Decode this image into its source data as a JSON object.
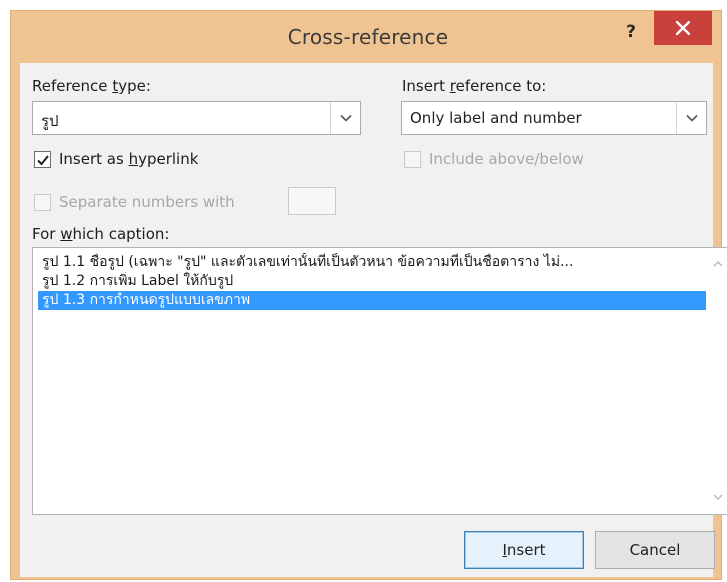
{
  "dialog": {
    "title": "Cross-reference",
    "help_label": "?",
    "close_label": "×"
  },
  "reference_type": {
    "label_prefix": "Reference ",
    "label_accel": "t",
    "label_suffix": "ype:",
    "value": "รูป"
  },
  "insert_reference_to": {
    "label_prefix": "Insert ",
    "label_accel": "r",
    "label_suffix": "eference to:",
    "value": "Only label and number"
  },
  "insert_as_hyperlink": {
    "label_prefix": "Insert as ",
    "label_accel": "h",
    "label_suffix": "yperlink",
    "checked": true
  },
  "include_above_below": {
    "label": "Include above/below",
    "checked": false,
    "enabled": false
  },
  "separate_numbers": {
    "label": "Separate numbers with",
    "checked": false,
    "enabled": false,
    "value": ""
  },
  "caption_list": {
    "label_prefix": "For ",
    "label_accel": "w",
    "label_suffix": "hich caption:",
    "items": [
      {
        "text": "รูป 1.1 ชื่อรูป (เฉพาะ \"รูป\" และตัวเลขเท่านั้นที่เป็นตัวหนา ข้อความที่เป็นชื่อตาราง ไม่...",
        "selected": false
      },
      {
        "text": "รูป 1.2 การเพิ่ม Label ให้กับรูป",
        "selected": false
      },
      {
        "text": "รูป 1.3 การกำหนดรูปแบบเลขภาพ",
        "selected": true
      }
    ]
  },
  "buttons": {
    "insert_accel": "I",
    "insert_rest": "nsert",
    "cancel_label": "Cancel"
  },
  "colors": {
    "frame": "#f0c492",
    "close": "#c8413a",
    "selection": "#3399ff",
    "client": "#f1f1f1"
  }
}
